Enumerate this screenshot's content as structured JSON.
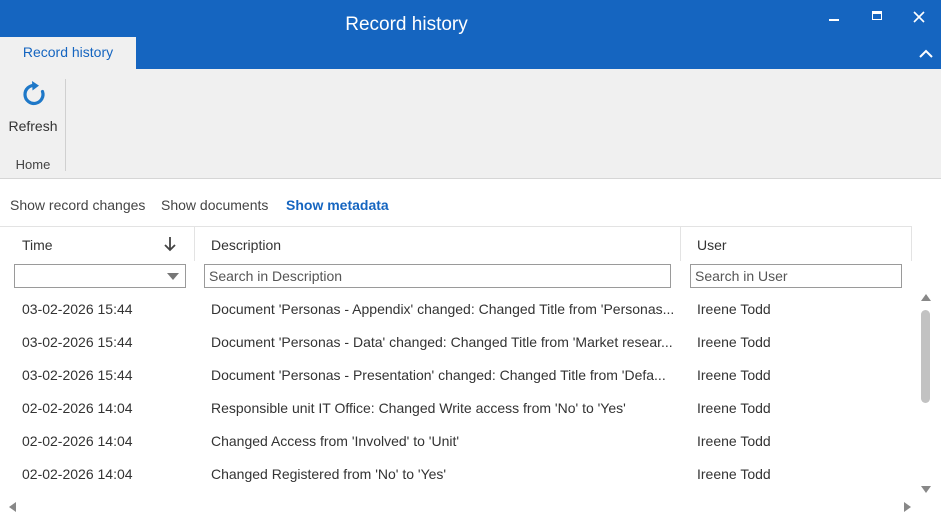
{
  "window": {
    "title": "Record history",
    "controls": [
      "minimize-icon",
      "maximize-icon",
      "close-icon"
    ]
  },
  "ribbon": {
    "tab_label": "Record history",
    "refresh_label": "Refresh",
    "refresh_icon": "refresh-icon",
    "group_label": "Home",
    "accent_color": "#1565c0"
  },
  "views": {
    "record_changes": "Show record changes",
    "documents": "Show documents",
    "metadata": "Show metadata",
    "active": "metadata"
  },
  "grid": {
    "columns": {
      "time": "Time",
      "description": "Description",
      "user": "User"
    },
    "sort_icon": "arrow-down-icon",
    "filters": {
      "time_value": "",
      "description_placeholder": "Search in Description",
      "user_placeholder": "Search in User"
    },
    "rows": [
      {
        "time": "03-02-2026 15:44",
        "description": "Document 'Personas - Appendix' changed: Changed Title from 'Personas...",
        "user": "Ireene Todd"
      },
      {
        "time": "03-02-2026 15:44",
        "description": "Document 'Personas - Data' changed: Changed Title from 'Market resear...",
        "user": "Ireene Todd"
      },
      {
        "time": "03-02-2026 15:44",
        "description": "Document 'Personas  - Presentation' changed: Changed Title from 'Defa...",
        "user": "Ireene Todd"
      },
      {
        "time": "02-02-2026 14:04",
        "description": "Responsible unit IT Office: Changed Write access from 'No' to 'Yes'",
        "user": "Ireene Todd"
      },
      {
        "time": "02-02-2026 14:04",
        "description": "Changed Access from 'Involved' to 'Unit'",
        "user": "Ireene Todd"
      },
      {
        "time": "02-02-2026 14:04",
        "description": "Changed Registered from 'No' to 'Yes'",
        "user": "Ireene Todd"
      }
    ]
  }
}
